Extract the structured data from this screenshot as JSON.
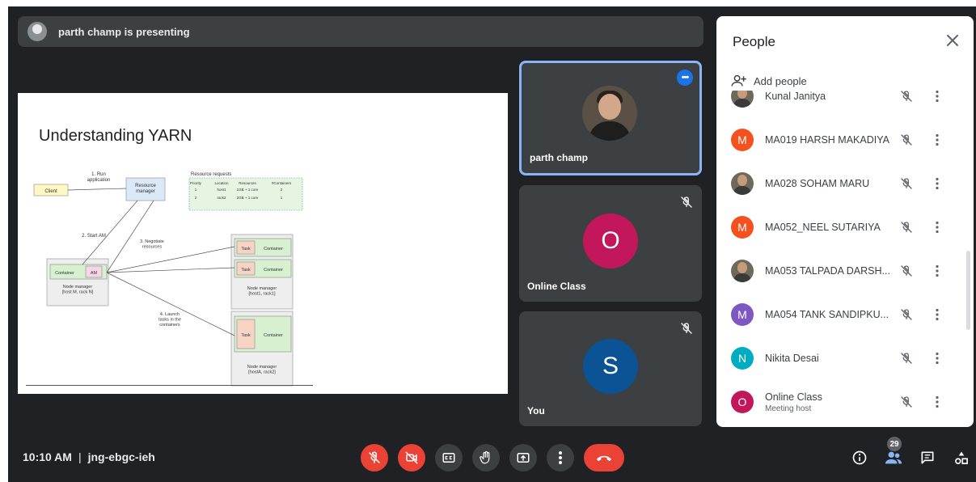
{
  "presenting_bar": {
    "text": "parth champ is presenting"
  },
  "slide": {
    "title": "Understanding YARN",
    "diagram": {
      "client": "Client",
      "run_application": "1. Run\napplication",
      "resource_manager": "Resource\nmanager",
      "resource_requests_title": "Resource requests",
      "resource_requests_header": [
        "Priority",
        "Location",
        "Resources",
        "#Containers"
      ],
      "resource_requests_rows": [
        [
          "1",
          "host1",
          "1GB + 1 core",
          "2"
        ],
        [
          "2",
          "rack2",
          "2GB + 1 core",
          "1"
        ]
      ],
      "start_am": "2. Start AM",
      "negotiate": "3. Negotiate\nresources",
      "container": "Container",
      "am": "AM",
      "task": "Task",
      "node_manager_m": "Node manager\n[host M, rack N]",
      "node_manager_1": "Node manager\n[host1, rack1]",
      "node_manager_a": "Node manager\n[hostA, rack2]",
      "launch": "4. Launch\ntasks in the\ncontainers"
    }
  },
  "tiles": [
    {
      "name": "parth champ",
      "type": "photo",
      "active": true
    },
    {
      "name": "Online Class",
      "type": "initial",
      "initial": "O",
      "color": "#c2185b",
      "muted": true
    },
    {
      "name": "You",
      "type": "initial",
      "initial": "S",
      "color": "#0b5394",
      "muted": true
    }
  ],
  "people_panel": {
    "title": "People",
    "add_people": "Add people",
    "participants": [
      {
        "name": "Kunal Janitya",
        "avatar": "photo"
      },
      {
        "name": "MA019 HARSH MAKADIYA",
        "avatar": "M",
        "color": "#f4511e"
      },
      {
        "name": "MA028 SOHAM MARU",
        "avatar": "photo"
      },
      {
        "name": "MA052_NEEL SUTARIYA",
        "avatar": "M",
        "color": "#f4511e"
      },
      {
        "name": "MA053 TALPADA DARSH...",
        "avatar": "photo"
      },
      {
        "name": "MA054 TANK SANDIPKU...",
        "avatar": "M",
        "color": "#7e57c2"
      },
      {
        "name": "Nikita Desai",
        "avatar": "N",
        "color": "#00acc1"
      },
      {
        "name": "Online Class",
        "sub": "Meeting host",
        "avatar": "O",
        "color": "#c2185b"
      }
    ]
  },
  "bottom_bar": {
    "time": "10:10 AM",
    "separator": "|",
    "meeting_code": "jng-ebgc-ieh",
    "participants_count": "29"
  },
  "colors": {
    "background": "#202124",
    "tile": "#3c4043",
    "accent": "#8ab4f8",
    "red": "#ea4335"
  }
}
